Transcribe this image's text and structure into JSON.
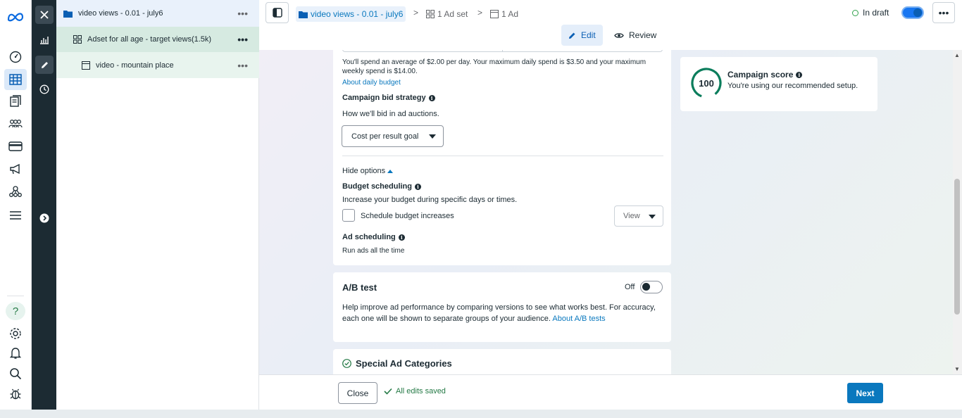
{
  "tree": {
    "campaign": "video views - 0.01 - july6",
    "adset": "Adset for all age - target views(1.5k)",
    "ad": "video - mountain place",
    "more": "•••"
  },
  "topbar": {
    "breadcrumb_campaign": "video views - 0.01 - july6",
    "breadcrumb_adset": "1 Ad set",
    "breadcrumb_ad": "1 Ad",
    "chevron": ">",
    "status": "In draft",
    "more": "•••",
    "edit_label": "Edit",
    "review_label": "Review"
  },
  "budget": {
    "spend_note": "You'll spend an average of $2.00 per day. Your maximum daily spend is $3.50 and your maximum weekly spend is $14.00.",
    "about_daily_budget": "About daily budget",
    "bid_strategy_label": "Campaign bid strategy",
    "bid_strategy_desc": "How we'll bid in ad auctions.",
    "bid_strategy_value": "Cost per result goal",
    "hide_options": "Hide options",
    "budget_scheduling_label": "Budget scheduling",
    "budget_scheduling_desc": "Increase your budget during specific days or times.",
    "schedule_checkbox_label": "Schedule budget increases",
    "view_button": "View",
    "ad_scheduling_label": "Ad scheduling",
    "ad_scheduling_desc": "Run ads all the time"
  },
  "ab_test": {
    "title": "A/B test",
    "toggle_state": "Off",
    "desc": "Help improve ad performance by comparing versions to see what works best. For accuracy, each one will be shown to separate groups of your audience.",
    "link": "About A/B tests"
  },
  "special_ad": {
    "title": "Special Ad Categories"
  },
  "score": {
    "value": "100",
    "title": "Campaign score",
    "subtitle": "You're using our recommended setup."
  },
  "footer": {
    "close": "Close",
    "saved": "All edits saved",
    "next": "Next"
  },
  "colors": {
    "accent": "#0a78be",
    "success": "#257a46",
    "dark_rail": "#1c2b33",
    "toggle_on": "#1877f2"
  }
}
